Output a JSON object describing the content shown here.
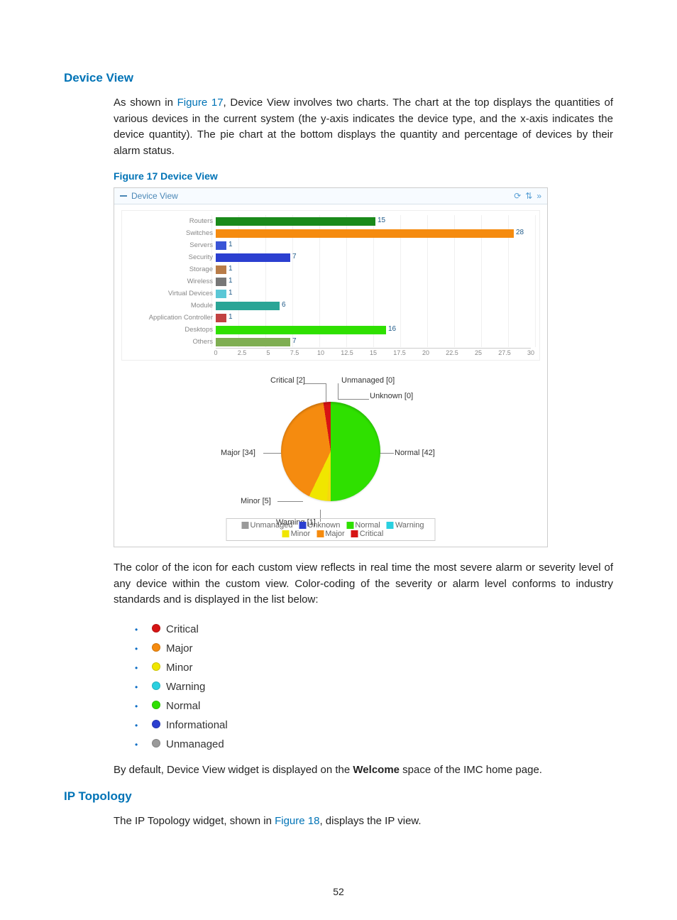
{
  "headings": {
    "device_view": "Device View",
    "ip_topology": "IP Topology"
  },
  "paragraphs": {
    "p1_a": "As shown in ",
    "p1_link": "Figure 17",
    "p1_b": ", Device View involves two charts. The chart at the top displays the quantities of various devices in the current system (the y-axis indicates the device type, and the x-axis indicates the device quantity). The pie chart at the bottom displays the quantity and percentage of devices by their alarm status.",
    "p2": "The color of the icon for each custom view reflects in real time the most severe alarm or severity level of any device within the custom view. Color-coding of the severity or alarm level conforms to industry standards and is displayed in the list below:",
    "p3_a": "By default, Device View widget is displayed on the ",
    "p3_b": "Welcome",
    "p3_c": " space of the IMC home page.",
    "p4_a": "The IP Topology widget, shown in ",
    "p4_link": "Figure 18",
    "p4_b": ", displays the IP view."
  },
  "figure_caption": "Figure 17 Device View",
  "panel_title": "Device View",
  "chart_data": [
    {
      "type": "bar",
      "orientation": "horizontal",
      "xlabel": "",
      "ylabel": "",
      "xlim": [
        0,
        30
      ],
      "xticks": [
        0,
        2.5,
        5,
        7.5,
        10,
        12.5,
        15,
        17.5,
        20,
        22.5,
        25,
        27.5,
        30
      ],
      "categories": [
        "Routers",
        "Switches",
        "Servers",
        "Security",
        "Storage",
        "Wireless",
        "Virtual Devices",
        "Module",
        "Application Controller",
        "Desktops",
        "Others"
      ],
      "values": [
        15,
        28,
        1,
        7,
        1,
        1,
        1,
        6,
        1,
        16,
        7
      ],
      "colors": [
        "#1a8a1a",
        "#f58b0f",
        "#3a55d6",
        "#2b3fd0",
        "#b87c48",
        "#777",
        "#5bc7d6",
        "#2aa596",
        "#c24242",
        "#2fe000",
        "#7fae52"
      ]
    },
    {
      "type": "pie",
      "title": "",
      "series": [
        {
          "name": "Unmanaged",
          "value": 0,
          "color": "#9a9a9a"
        },
        {
          "name": "Unknown",
          "value": 0,
          "color": "#2b3fd0"
        },
        {
          "name": "Normal",
          "value": 42,
          "color": "#2fe000"
        },
        {
          "name": "Warning",
          "value": 1,
          "color": "#2ad0e0"
        },
        {
          "name": "Minor",
          "value": 5,
          "color": "#f0e600"
        },
        {
          "name": "Major",
          "value": 34,
          "color": "#f58b0f"
        },
        {
          "name": "Critical",
          "value": 2,
          "color": "#d61414"
        }
      ]
    }
  ],
  "pie_labels": {
    "critical": "Critical",
    "unmanaged": "Unmanaged",
    "unknown": "Unknown",
    "normal": "Normal",
    "minor": "Minor",
    "warning": "Warning",
    "major": "Major"
  },
  "pie_counts": {
    "critical": "[2]",
    "unmanaged": "[0]",
    "unknown": "[0]",
    "normal": "[42]",
    "minor": "[5]",
    "warning": "[1]",
    "major": "[34]"
  },
  "legend_order": [
    "Unmanaged",
    "Unknown",
    "Normal",
    "Warning",
    "Minor",
    "Major",
    "Critical"
  ],
  "severity_list": [
    {
      "label": "Critical",
      "color": "#d61414"
    },
    {
      "label": "Major",
      "color": "#f58b0f"
    },
    {
      "label": "Minor",
      "color": "#f0e600"
    },
    {
      "label": "Warning",
      "color": "#2ad0e0"
    },
    {
      "label": "Normal",
      "color": "#2fe000"
    },
    {
      "label": "Informational",
      "color": "#2b3fd0"
    },
    {
      "label": "Unmanaged",
      "color": "#9a9a9a"
    }
  ],
  "page_number": "52"
}
